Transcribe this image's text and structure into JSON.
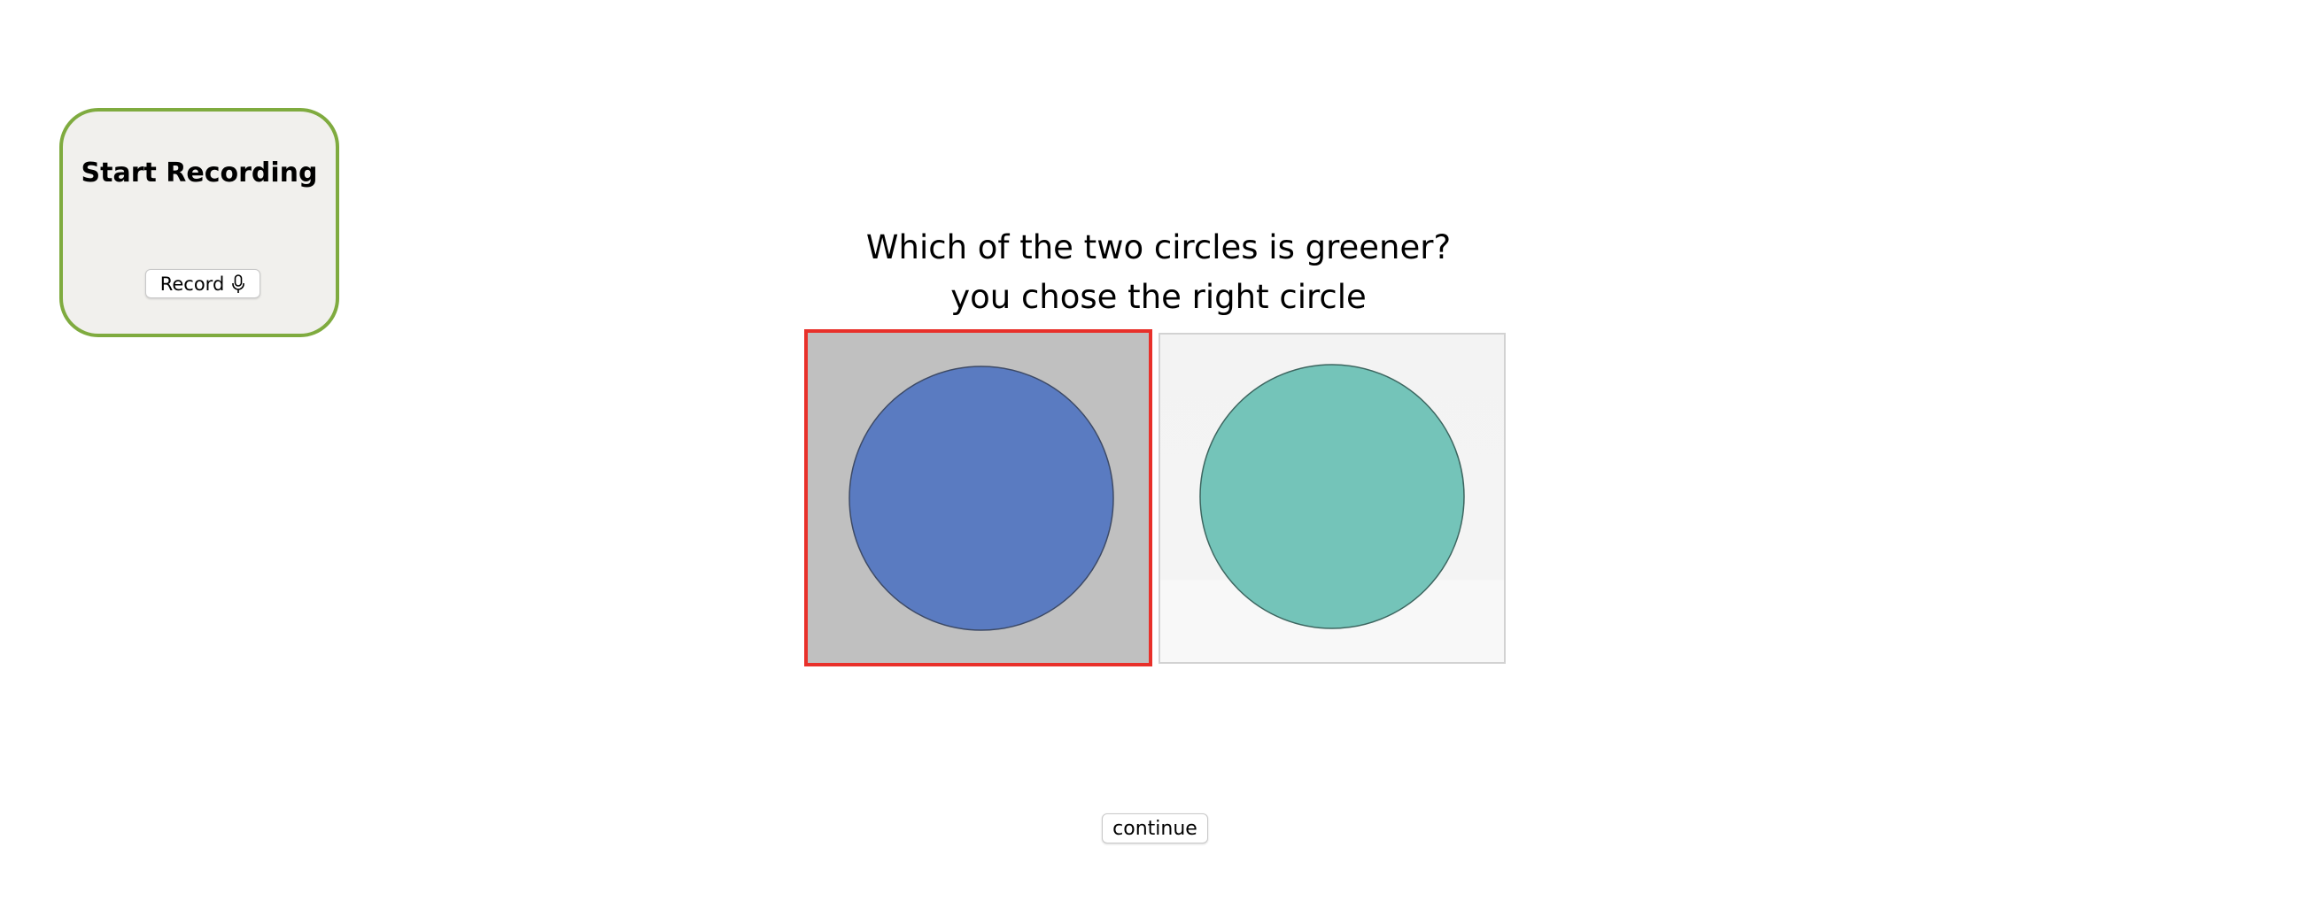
{
  "recording": {
    "title": "Start Recording",
    "record_label": "Record",
    "record_icon": "microphone-icon",
    "border_color": "#7fab3f",
    "background_color": "#f1f0ed"
  },
  "question": {
    "prompt": "Which of the two circles is greener?",
    "feedback": "you chose the right circle"
  },
  "choices": [
    {
      "name": "left",
      "circle_color": "#5a7bc1",
      "background_color": "#c0c0c0",
      "selected": true,
      "selection_color": "#e8302a"
    },
    {
      "name": "right",
      "circle_color": "#74c4b9",
      "background_color": "#f3f3f3",
      "selected": false
    }
  ],
  "continue_label": "continue"
}
